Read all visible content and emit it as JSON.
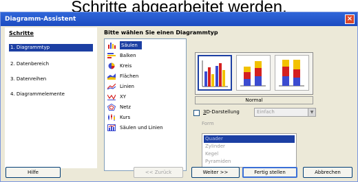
{
  "caption": "Schritte abgearbeitet werden.",
  "window": {
    "title": "Diagramm-Assistent",
    "close": "×"
  },
  "steps": {
    "heading": "Schritte",
    "items": [
      {
        "label": "1. Diagrammtyp",
        "active": true
      },
      {
        "label": "2. Datenbereich",
        "active": false
      },
      {
        "label": "3. Datenreihen",
        "active": false
      },
      {
        "label": "4. Diagrammelemente",
        "active": false
      }
    ]
  },
  "prompt": "Bitte wählen Sie einen Diagrammtyp",
  "chart_types": [
    {
      "label": "Säulen",
      "icon": "column-chart-icon",
      "active": true
    },
    {
      "label": "Balken",
      "icon": "bar-chart-icon",
      "active": false
    },
    {
      "label": "Kreis",
      "icon": "pie-chart-icon",
      "active": false
    },
    {
      "label": "Flächen",
      "icon": "area-chart-icon",
      "active": false
    },
    {
      "label": "Linien",
      "icon": "line-chart-icon",
      "active": false
    },
    {
      "label": "XY",
      "icon": "xy-chart-icon",
      "active": false
    },
    {
      "label": "Netz",
      "icon": "net-chart-icon",
      "active": false
    },
    {
      "label": "Kurs",
      "icon": "stock-chart-icon",
      "active": false
    },
    {
      "label": "Säulen und Linien",
      "icon": "column-line-chart-icon",
      "active": false
    }
  ],
  "variants": {
    "selected_label": "Normal"
  },
  "options": {
    "three_d_label_mnemonic": "3",
    "three_d_label_rest": "D-Darstellung",
    "three_d_checked": false,
    "shading_value": "Einfach",
    "form_label": "Form",
    "form_items": [
      "Quader",
      "Zylinder",
      "Kegel",
      "Pyramiden"
    ]
  },
  "buttons": {
    "help": "Hilfe",
    "back": "<< Zurück",
    "next": "Weiter >>",
    "finish": "Fertig stellen",
    "cancel": "Abbrechen"
  },
  "colors": {
    "accent": "#1c3fa3",
    "bar_red": "#d42020",
    "bar_yellow": "#f2c200",
    "bar_blue": "#3b4bd0"
  }
}
